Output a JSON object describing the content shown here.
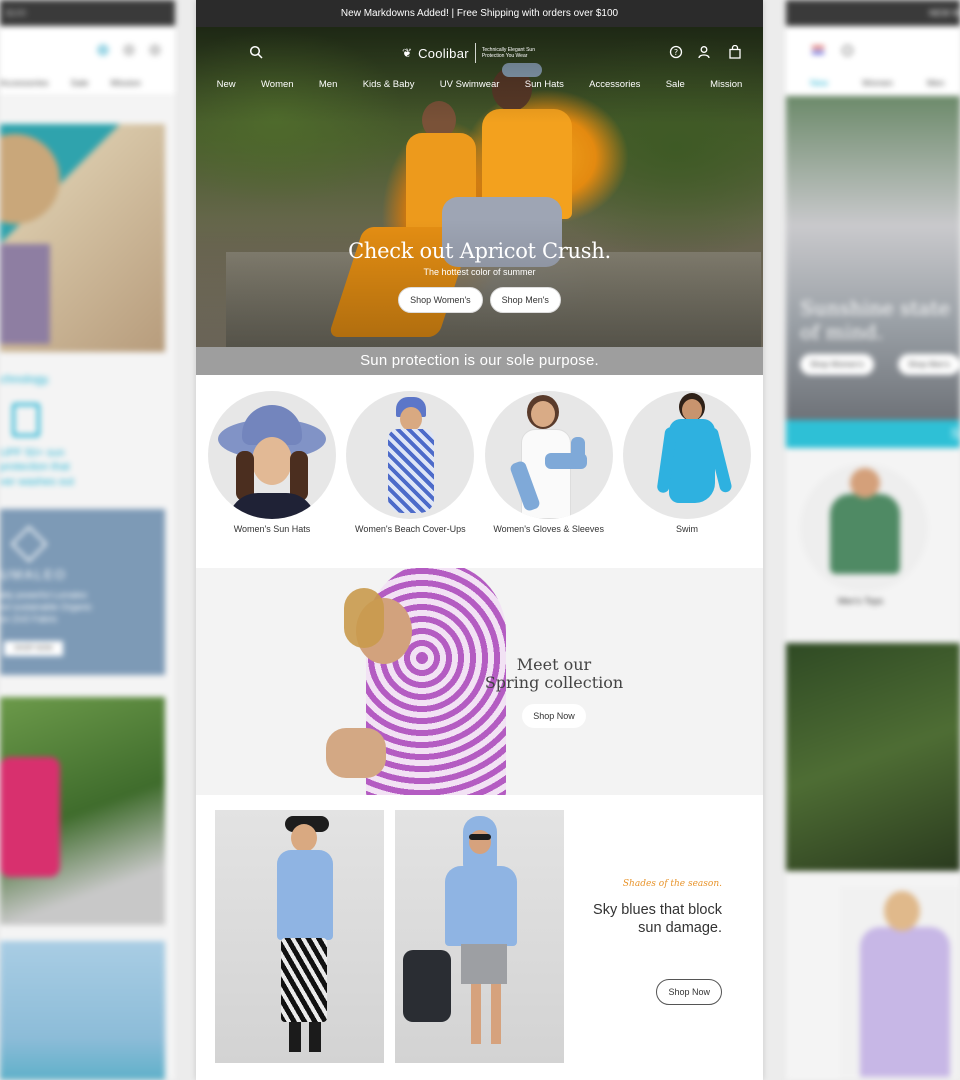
{
  "left_panel": {
    "promo": "$100",
    "nav": [
      "Accessories",
      "Sale",
      "Mission"
    ],
    "tech_heading": "chnology.",
    "tech_text": [
      "UPF 50+ sun",
      "protection that",
      "ver washes out"
    ],
    "brand": "UMALEO",
    "brand_text": [
      "ally powerful Lumaleo",
      "nd sustainable Organic",
      "on ZnO Fabric"
    ],
    "shop_btn": "SHOP NOW"
  },
  "right_panel": {
    "promo": "NEW M",
    "nav": [
      "New",
      "Women",
      "Men"
    ],
    "headline_line1": "Sunshine state",
    "headline_line2": "of mind.",
    "btn_women": "Shop Women's",
    "btn_men": "Shop Men's",
    "teal_letter": "S",
    "cat_label": "Men's Tops"
  },
  "promo": "New Markdowns Added! | Free Shipping with orders over $100",
  "logo": {
    "name": "Coolibar",
    "tagline": "Technically Elegant Sun Protection You Wear"
  },
  "nav": [
    "New",
    "Women",
    "Men",
    "Kids & Baby",
    "UV Swimwear",
    "Sun Hats",
    "Accessories",
    "Sale",
    "Mission"
  ],
  "hero": {
    "title": "Check out Apricot Crush.",
    "subtitle": "The hottest color of summer",
    "btn_women": "Shop Women's",
    "btn_men": "Shop Men's"
  },
  "sunbar": "Sun protection is our sole purpose.",
  "categories": [
    {
      "label": "Women's Sun Hats"
    },
    {
      "label": "Women's Beach Cover-Ups"
    },
    {
      "label": "Women's Gloves & Sleeves"
    },
    {
      "label": "Swim"
    }
  ],
  "spring": {
    "title_line1": "Meet our",
    "title_line2": "Spring collection",
    "btn": "Shop Now"
  },
  "sky": {
    "eyebrow": "Shades of the season.",
    "title_line1": "Sky blues that block",
    "title_line2": "sun damage.",
    "btn": "Shop Now"
  },
  "colors": {
    "promo_bg": "#2b2b2b",
    "sunbar_bg": "#9e9e9e",
    "accent_orange": "#e8942b",
    "accent_teal": "#29b5d4"
  }
}
